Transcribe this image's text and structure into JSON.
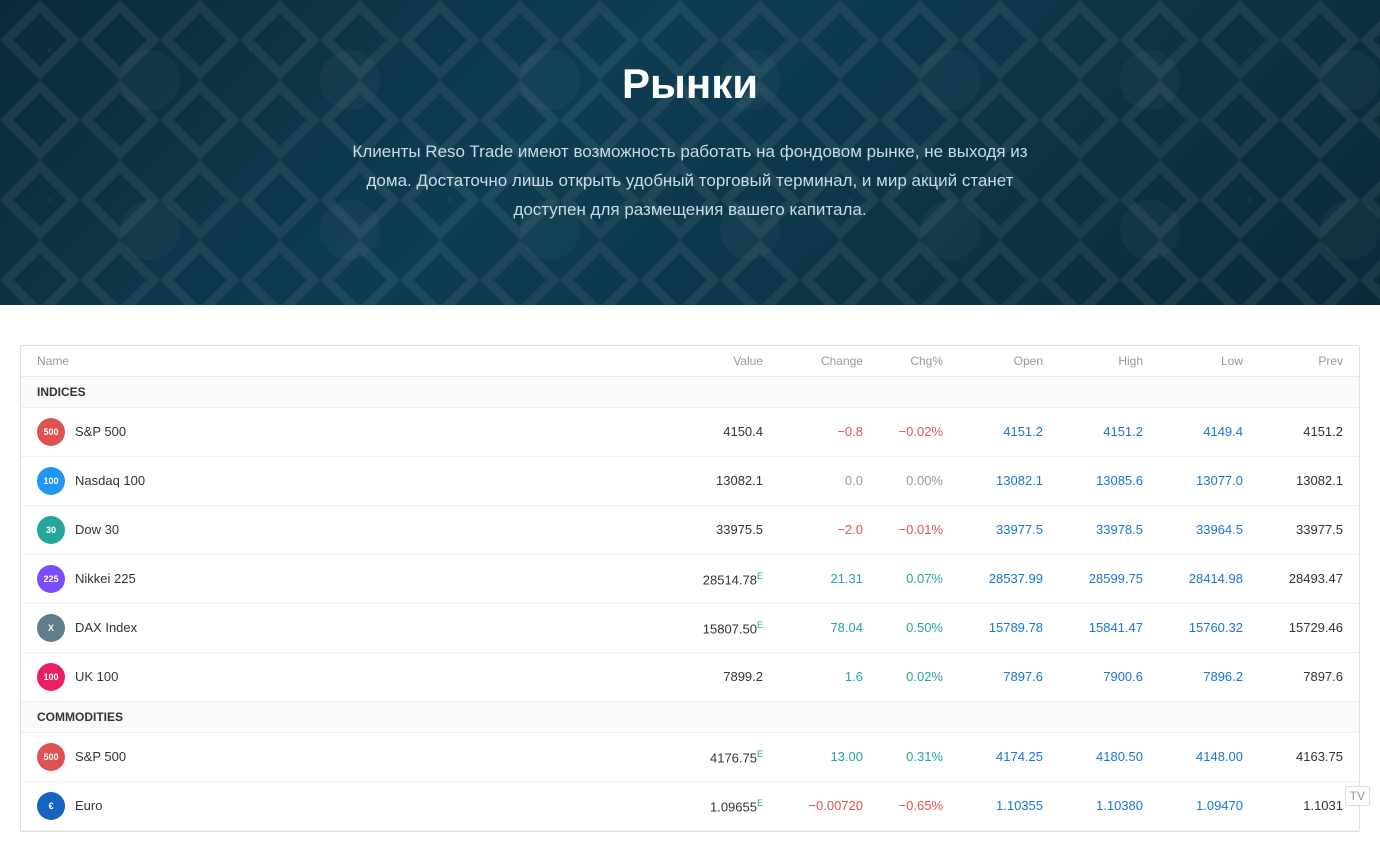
{
  "hero": {
    "title": "Рынки",
    "description": "Клиенты Reso Trade имеют возможность работать на фондовом рынке, не выходя из дома. Достаточно лишь открыть удобный торговый терминал, и мир акций станет доступен для размещения вашего капитала."
  },
  "table": {
    "columns": {
      "name": "Name",
      "value": "Value",
      "change": "Change",
      "chgpct": "Chg%",
      "open": "Open",
      "high": "High",
      "low": "Low",
      "prev": "Prev"
    },
    "sections": [
      {
        "label": "INDICES",
        "rows": [
          {
            "badge": "500",
            "badge_class": "badge-500",
            "name": "S&P 500",
            "value": "4150.4",
            "change": "−0.8",
            "change_type": "neg",
            "chgpct": "−0.02%",
            "chgpct_type": "neg",
            "open": "4151.2",
            "high": "4151.2",
            "low": "4149.4",
            "prev": "4151.2"
          },
          {
            "badge": "100",
            "badge_class": "badge-100",
            "name": "Nasdaq 100",
            "value": "13082.1",
            "change": "0.0",
            "change_type": "neu",
            "chgpct": "0.00%",
            "chgpct_type": "neu",
            "open": "13082.1",
            "high": "13085.6",
            "low": "13077.0",
            "prev": "13082.1"
          },
          {
            "badge": "30",
            "badge_class": "badge-30",
            "name": "Dow 30",
            "value": "33975.5",
            "change": "−2.0",
            "change_type": "neg",
            "chgpct": "−0.01%",
            "chgpct_type": "neg",
            "open": "33977.5",
            "high": "33978.5",
            "low": "33964.5",
            "prev": "33977.5"
          },
          {
            "badge": "225",
            "badge_class": "badge-225",
            "name": "Nikkei 225",
            "value": "28514.78",
            "value_superscript": "E",
            "change": "21.31",
            "change_type": "pos",
            "chgpct": "0.07%",
            "chgpct_type": "pos",
            "open": "28537.99",
            "high": "28599.75",
            "low": "28414.98",
            "prev": "28493.47"
          },
          {
            "badge": "X",
            "badge_class": "badge-x",
            "name": "DAX Index",
            "value": "15807.50",
            "value_superscript": "E",
            "change": "78.04",
            "change_type": "pos",
            "chgpct": "0.50%",
            "chgpct_type": "pos",
            "open": "15789.78",
            "high": "15841.47",
            "low": "15760.32",
            "prev": "15729.46"
          },
          {
            "badge": "100",
            "badge_class": "badge-uk",
            "name": "UK 100",
            "value": "7899.2",
            "change": "1.6",
            "change_type": "pos",
            "chgpct": "0.02%",
            "chgpct_type": "pos",
            "open": "7897.6",
            "high": "7900.6",
            "low": "7896.2",
            "prev": "7897.6"
          }
        ]
      },
      {
        "label": "COMMODITIES",
        "rows": [
          {
            "badge": "500",
            "badge_class": "badge-500",
            "name": "S&P 500",
            "value": "4176.75",
            "value_superscript": "E",
            "change": "13.00",
            "change_type": "pos",
            "chgpct": "0.31%",
            "chgpct_type": "pos",
            "open": "4174.25",
            "high": "4180.50",
            "low": "4148.00",
            "prev": "4163.75"
          },
          {
            "badge": "€",
            "badge_class": "badge-euro",
            "name": "Euro",
            "value": "1.09655",
            "value_superscript": "E",
            "change": "−0.00720",
            "change_type": "neg",
            "chgpct": "−0.65%",
            "chgpct_type": "neg",
            "open": "1.10355",
            "high": "1.10380",
            "low": "1.09470",
            "prev": "1.1031"
          }
        ]
      }
    ]
  }
}
